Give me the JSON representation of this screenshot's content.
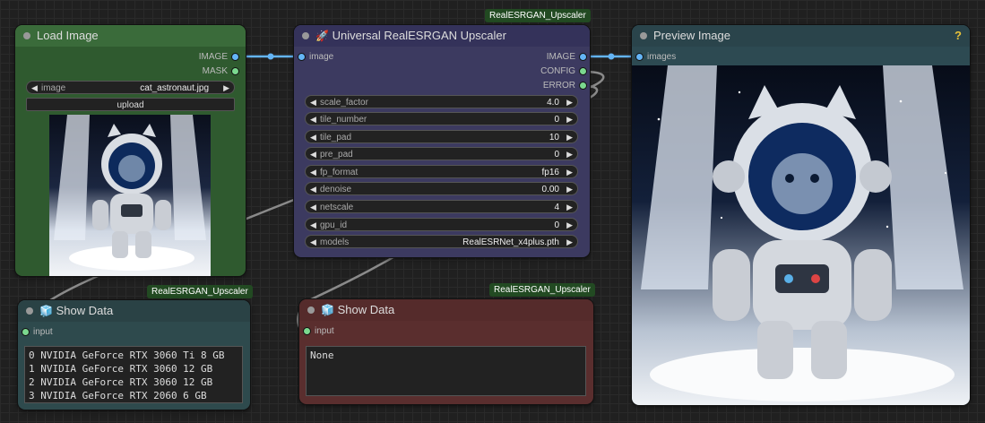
{
  "colors": {
    "load_node_bg": "#2f5a2f",
    "load_node_header": "#3a6b3a",
    "upscaler_node_bg": "#3c3a60",
    "upscaler_node_header": "#34325a",
    "preview_node_bg": "#2d4a52",
    "showdata1_bg": "#2e4a4d",
    "showdata2_bg": "#5a2e2e",
    "wire_blue": "#64b5f6",
    "wire_grey": "#8a8a8a",
    "badge_bg": "#224a22"
  },
  "load_image": {
    "title": "Load Image",
    "outputs": [
      "IMAGE",
      "MASK"
    ],
    "image_widget": {
      "label": "image",
      "value": "cat_astronaut.jpg"
    },
    "upload_label": "upload",
    "thumbnail_icon": "cat-astronaut-image"
  },
  "upscaler": {
    "badge": "RealESRGAN_Upscaler",
    "icon": "rocket-icon",
    "title_icon": "🚀",
    "title": "Universal RealESRGAN Upscaler",
    "input": "image",
    "outputs": [
      "IMAGE",
      "CONFIG",
      "ERROR"
    ],
    "widgets": [
      {
        "label": "scale_factor",
        "value": "4.0"
      },
      {
        "label": "tile_number",
        "value": "0"
      },
      {
        "label": "tile_pad",
        "value": "10"
      },
      {
        "label": "pre_pad",
        "value": "0"
      },
      {
        "label": "fp_format",
        "value": "fp16"
      },
      {
        "label": "denoise",
        "value": "0.00"
      },
      {
        "label": "netscale",
        "value": "4"
      },
      {
        "label": "gpu_id",
        "value": "0"
      },
      {
        "label": "models",
        "value": "RealESRNet_x4plus.pth"
      }
    ]
  },
  "preview": {
    "title": "Preview Image",
    "help": "?",
    "input": "images",
    "image_icon": "cat-astronaut-image"
  },
  "show_data_1": {
    "badge": "RealESRGAN_Upscaler",
    "title_icon": "🧊",
    "title": "Show Data",
    "input": "input",
    "lines": [
      "0 NVIDIA GeForce RTX 3060 Ti 8 GB",
      "1 NVIDIA GeForce RTX 3060 12 GB",
      "2 NVIDIA GeForce RTX 3060 12 GB",
      "3 NVIDIA GeForce RTX 2060 6 GB"
    ]
  },
  "show_data_2": {
    "badge": "RealESRGAN_Upscaler",
    "title_icon": "🧊",
    "title": "Show Data",
    "input": "input",
    "lines": [
      "None"
    ]
  }
}
